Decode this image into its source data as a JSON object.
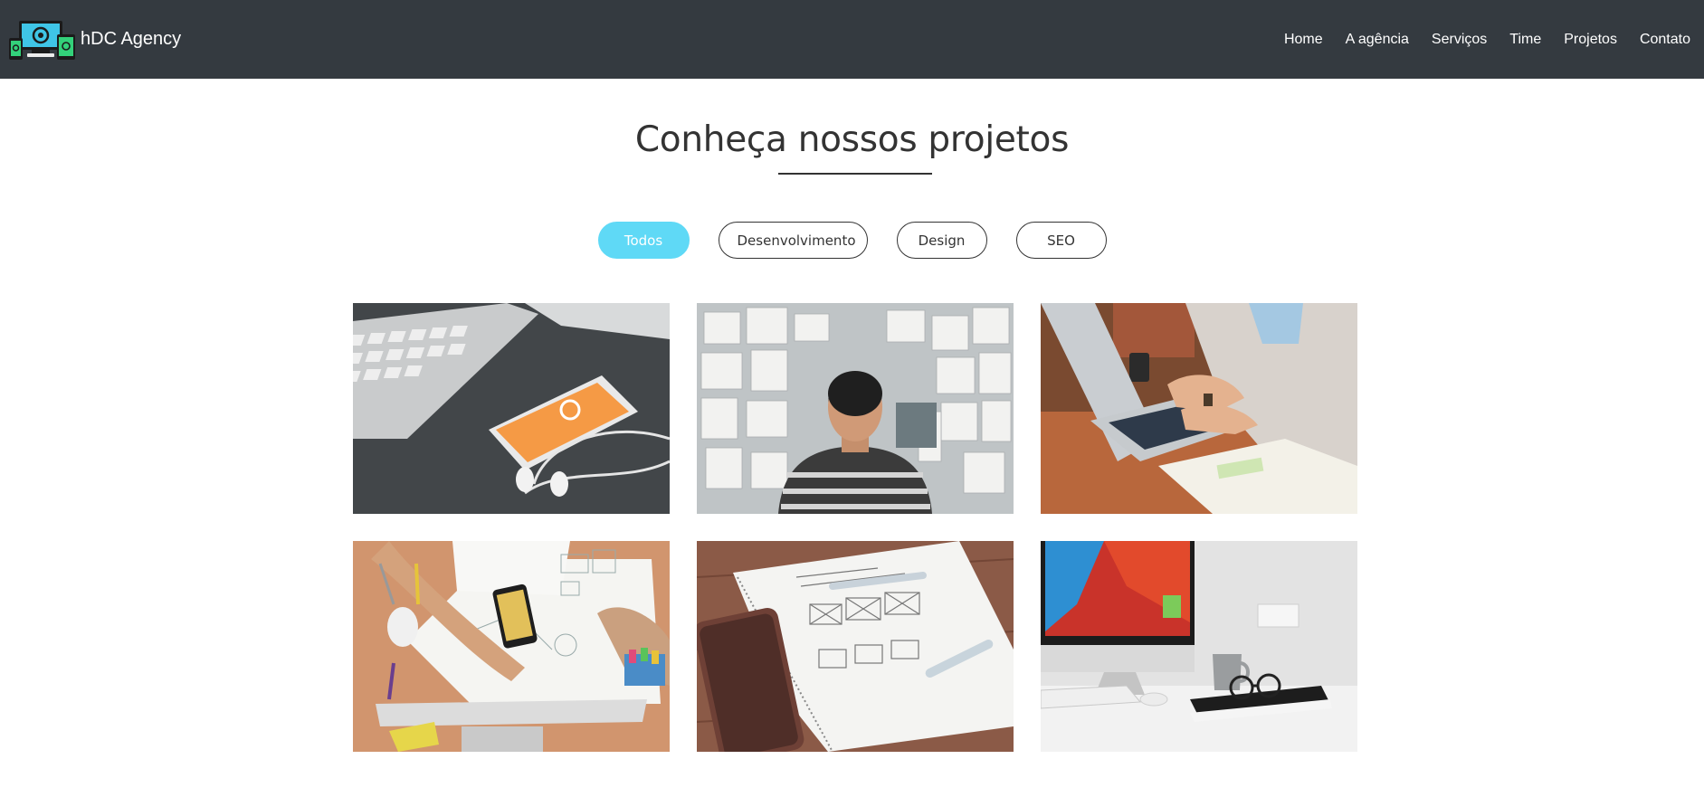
{
  "navbar": {
    "brand": "hDC Agency",
    "links": [
      "Home",
      "A agência",
      "Serviços",
      "Time",
      "Projetos",
      "Contato"
    ]
  },
  "projects": {
    "title": "Conheça nossos projetos",
    "filters": [
      "Todos",
      "Desenvolvimento",
      "Design",
      "SEO"
    ],
    "active_filter": "Todos",
    "items": [
      {
        "icon": "phone-keyboard-photo"
      },
      {
        "icon": "man-wall-sketches-photo"
      },
      {
        "icon": "woman-laptop-photo"
      },
      {
        "icon": "hands-drawing-photo"
      },
      {
        "icon": "notebook-wireframe-photo"
      },
      {
        "icon": "imac-desk-photo"
      }
    ]
  },
  "colors": {
    "navbar_bg": "#343a40",
    "accent": "#5fd9f6",
    "text": "#333333"
  }
}
